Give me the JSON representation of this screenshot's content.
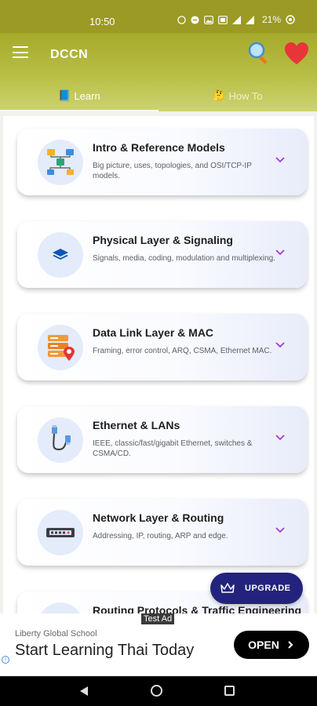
{
  "status": {
    "time": "10:50",
    "battery": "21%",
    "icons": [
      "whatsapp-icon",
      "dnd-icon",
      "photo-icon",
      "sim-icon",
      "signal-icon",
      "signal-icon",
      "battery-icon"
    ]
  },
  "app": {
    "title": "DCCN",
    "accent": "#a6aa2c",
    "tabs": [
      {
        "emoji": "📘",
        "label": "Learn"
      },
      {
        "emoji": "🤔",
        "label": "How To"
      }
    ]
  },
  "topics": [
    {
      "title": "Intro & Reference Models",
      "desc": "Big picture, uses, topologies, and OSI/TCP-IP models.",
      "icon": "network-diagram-icon"
    },
    {
      "title": "Physical Layer & Signaling",
      "desc": "Signals, media, coding, modulation and multiplexing.",
      "icon": "layers-icon"
    },
    {
      "title": "Data Link Layer & MAC",
      "desc": "Framing, error control, ARQ, CSMA, Ethernet MAC.",
      "icon": "server-ip-icon"
    },
    {
      "title": "Ethernet & LANs",
      "desc": "IEEE, classic/fast/gigabit Ethernet, switches & CSMA/CD.",
      "icon": "ethernet-cable-icon"
    },
    {
      "title": "Network Layer & Routing",
      "desc": "Addressing, IP, routing, ARP and edge.",
      "icon": "router-icon"
    },
    {
      "title": "Routing Protocols & Traffic Engineering",
      "desc": "",
      "icon": "routing-icon"
    }
  ],
  "fab": {
    "label": "UPGRADE"
  },
  "ad": {
    "tag": "Test Ad",
    "sponsor": "Liberty Global School",
    "headline": "Start Learning Thai Today",
    "cta": "OPEN"
  }
}
